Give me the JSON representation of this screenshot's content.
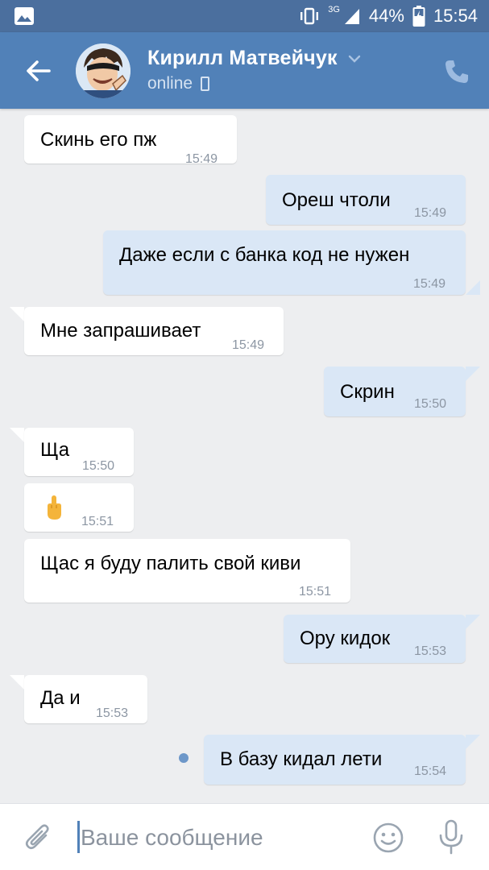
{
  "status_bar": {
    "network": "3G",
    "battery": "44%",
    "time": "15:54"
  },
  "header": {
    "contact_name": "Кирилл Матвейчук",
    "status": "online",
    "icons": [
      "back-arrow-icon",
      "chevron-down-icon",
      "mobile-phone-icon",
      "phone-call-icon"
    ]
  },
  "messages": [
    {
      "dir": "in",
      "text": "Скинь его пж",
      "time": "15:49"
    },
    {
      "dir": "out",
      "text": "Ореш чтоли",
      "time": "15:49"
    },
    {
      "dir": "out",
      "text": "Даже если с банка код не нужен",
      "time": "15:49"
    },
    {
      "dir": "in",
      "text": "Мне запрашивает",
      "time": "15:49"
    },
    {
      "dir": "out",
      "text": "Скрин",
      "time": "15:50"
    },
    {
      "dir": "in",
      "text": "Ща",
      "time": "15:50"
    },
    {
      "dir": "in",
      "text": "",
      "emoji": "middle-finger-emoji",
      "time": "15:51"
    },
    {
      "dir": "in",
      "text": "Щас я буду палить свой киви",
      "time": "15:51"
    },
    {
      "dir": "out",
      "text": "Ору кидок",
      "time": "15:53"
    },
    {
      "dir": "in",
      "text": "Да и",
      "time": "15:53"
    },
    {
      "dir": "out",
      "text": "В базу кидал лети",
      "time": "15:54",
      "unread": true
    }
  ],
  "composer": {
    "placeholder": "Ваше сообщение",
    "value": "",
    "icons": [
      "paperclip-icon",
      "smile-icon",
      "microphone-icon"
    ]
  },
  "colors": {
    "status_bar": "#4b6f9e",
    "header": "#5181b8",
    "chat_background": "#edeef0",
    "incoming_bubble": "#ffffff",
    "outgoing_bubble": "#dae7f6",
    "timestamp": "#8c96a3",
    "unread_dot": "#6d97c9"
  }
}
